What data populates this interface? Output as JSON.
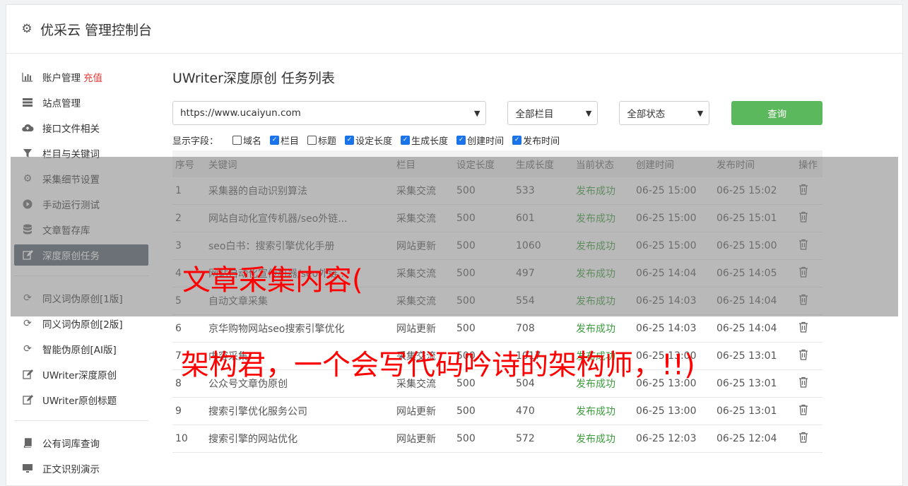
{
  "header": {
    "title": "优采云 管理控制台",
    "icon": "gear-icon"
  },
  "sidebar": {
    "items": [
      {
        "label": "账户管理",
        "icon": "bar-chart-icon",
        "extra": "充值"
      },
      {
        "label": "站点管理",
        "icon": "server-icon"
      },
      {
        "label": "接口文件相关",
        "icon": "cloud-upload-icon"
      },
      {
        "label": "栏目与关键词",
        "icon": "filter-icon"
      },
      {
        "label": "采集细节设置",
        "icon": "gears-icon"
      },
      {
        "label": "手动运行测试",
        "icon": "play-icon"
      },
      {
        "label": "文章暂存库",
        "icon": "database-icon"
      },
      {
        "label": "深度原创任务",
        "icon": "edit-icon"
      }
    ],
    "items2": [
      {
        "label": "同义词伪原创[1版]",
        "icon": "refresh-icon"
      },
      {
        "label": "同义词伪原创[2版]",
        "icon": "refresh-icon"
      },
      {
        "label": "智能伪原创[AI版]",
        "icon": "refresh-icon"
      },
      {
        "label": "UWriter深度原创",
        "icon": "edit-icon"
      },
      {
        "label": "UWriter原创标题",
        "icon": "edit-icon"
      }
    ],
    "items3": [
      {
        "label": "公有词库查询",
        "icon": "book-icon"
      },
      {
        "label": "正文识别演示",
        "icon": "monitor-icon"
      }
    ]
  },
  "main": {
    "title": "UWriter深度原创 任务列表",
    "site_select": "https://www.ucaiyun.com",
    "column_select": "全部栏目",
    "status_select": "全部状态",
    "query_label": "查询",
    "fields_label": "显示字段：",
    "fields": [
      {
        "label": "域名",
        "checked": false
      },
      {
        "label": "栏目",
        "checked": true
      },
      {
        "label": "标题",
        "checked": false
      },
      {
        "label": "设定长度",
        "checked": true
      },
      {
        "label": "生成长度",
        "checked": true
      },
      {
        "label": "创建时间",
        "checked": true
      },
      {
        "label": "发布时间",
        "checked": true
      }
    ]
  },
  "table": {
    "headers": [
      "序号",
      "关键词",
      "栏目",
      "设定长度",
      "生成长度",
      "当前状态",
      "创建时间",
      "发布时间",
      "操作"
    ],
    "rows": [
      [
        "1",
        "采集器的自动识别算法",
        "采集交流",
        "500",
        "533",
        "发布成功",
        "06-25 15:00",
        "06-25 15:02"
      ],
      [
        "2",
        "网站自动化宣传机器/seo外链...",
        "采集交流",
        "500",
        "601",
        "发布成功",
        "06-25 15:00",
        "06-25 15:01"
      ],
      [
        "3",
        "seo白书：搜索引擎优化手册",
        "网站更新",
        "500",
        "1060",
        "发布成功",
        "06-25 15:00",
        "06-25 15:00"
      ],
      [
        "4",
        "网站自动化宣传机器/seo外链...",
        "采集交流",
        "500",
        "497",
        "发布成功",
        "06-25 14:04",
        "06-25 14:05"
      ],
      [
        "5",
        "自动文章采集",
        "采集交流",
        "500",
        "554",
        "发布成功",
        "06-25 14:03",
        "06-25 14:04"
      ],
      [
        "6",
        "京华购物网站seo搜索引擎优化",
        "网站更新",
        "500",
        "708",
        "发布成功",
        "06-25 14:03",
        "06-25 14:04"
      ],
      [
        "7",
        "内容采集",
        "采集交流",
        "500",
        "1017",
        "发布成功",
        "06-25 13:00",
        "06-25 13:01"
      ],
      [
        "8",
        "公众号文章伪原创",
        "采集交流",
        "500",
        "504",
        "发布成功",
        "06-25 13:00",
        "06-25 13:01"
      ],
      [
        "9",
        "搜索引擎优化服务公司",
        "网站更新",
        "500",
        "470",
        "发布成功",
        "06-25 13:00",
        "06-25 13:01"
      ],
      [
        "10",
        "搜索引擎的网站优化",
        "网站更新",
        "500",
        "572",
        "发布成功",
        "06-25 12:03",
        "06-25 12:04"
      ]
    ]
  },
  "watermark": {
    "line1": "文章采集内容(",
    "line2": "架构君，一个会写代码吟诗的架构师，!!)"
  }
}
